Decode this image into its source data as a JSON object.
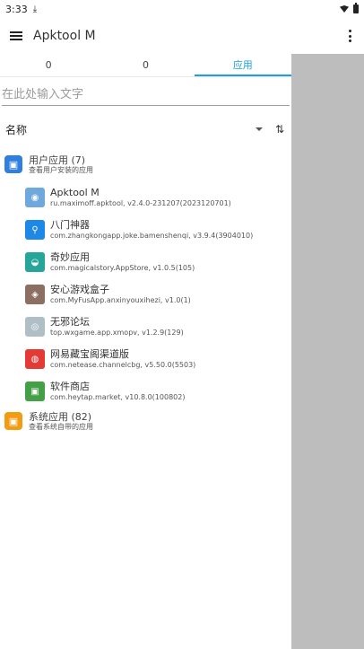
{
  "status_bar": {
    "time": "3:33",
    "download_glyph": "⤓"
  },
  "app_bar": {
    "title": "Apktool M"
  },
  "tabs": [
    {
      "label": "0"
    },
    {
      "label": "0"
    },
    {
      "label": "应用"
    }
  ],
  "search": {
    "placeholder": "在此处输入文字"
  },
  "sort": {
    "label": "名称"
  },
  "user_group": {
    "title": "用户应用 (7)",
    "subtitle": "查看用户安装的应用",
    "color": "#2f7fe0"
  },
  "apps": [
    {
      "name": "Apktool M",
      "detail": "ru.maximoff.apktool, v2.4.0-231207(2023120701)",
      "color": "#6fa8dc",
      "glyph": "◉"
    },
    {
      "name": "八门神器",
      "detail": "com.zhangkongapp.joke.bamenshenqi, v3.9.4(3904010)",
      "color": "#1e88e5",
      "glyph": "⚲"
    },
    {
      "name": "奇妙应用",
      "detail": "com.magicalstory.AppStore, v1.0.5(105)",
      "color": "#26a69a",
      "glyph": "◒"
    },
    {
      "name": "安心游戏盒子",
      "detail": "com.MyFusApp.anxinyouxihezi, v1.0(1)",
      "color": "#8d6e63",
      "glyph": "◈"
    },
    {
      "name": "无邪论坛",
      "detail": "top.wxgame.app.xmopv, v1.2.9(129)",
      "color": "#b0bec5",
      "glyph": "◎"
    },
    {
      "name": "网易藏宝阁渠道版",
      "detail": "com.netease.channelcbg, v5.50.0(5503)",
      "color": "#e53935",
      "glyph": "◍"
    },
    {
      "name": "软件商店",
      "detail": "com.heytap.market, v10.8.0(100802)",
      "color": "#43a047",
      "glyph": "▣"
    }
  ],
  "system_group": {
    "title": "系统应用 (82)",
    "subtitle": "查看系统自带的应用",
    "color": "#f39c12"
  }
}
